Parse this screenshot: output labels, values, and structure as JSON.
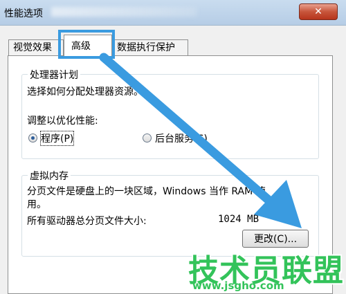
{
  "window": {
    "title": "性能选项",
    "close_glyph": "✕"
  },
  "tabs": [
    {
      "label": "视觉效果",
      "active": false
    },
    {
      "label": "高级",
      "active": true
    },
    {
      "label": "数据执行保护",
      "active": false
    }
  ],
  "processor_scheduling": {
    "legend": "处理器计划",
    "description": "选择如何分配处理器资源。",
    "adjust_label": "调整以优化性能:",
    "options": [
      {
        "label": "程序(P)",
        "checked": true
      },
      {
        "label": "后台服务(S)",
        "checked": false
      }
    ]
  },
  "virtual_memory": {
    "legend": "虚拟内存",
    "desc_line1": "分页文件是硬盘上的一块区域，Windows 当作 RAM 使",
    "desc_line2": "用。",
    "total_label": "所有驱动器总分页文件大小:",
    "total_value": "1024 MB",
    "change_button": "更改(C)..."
  },
  "watermark": {
    "brand": "技术员联盟",
    "url": "www.jsgho.com"
  },
  "colors": {
    "highlight": "#3a9be0",
    "watermark": "#33c35a"
  }
}
